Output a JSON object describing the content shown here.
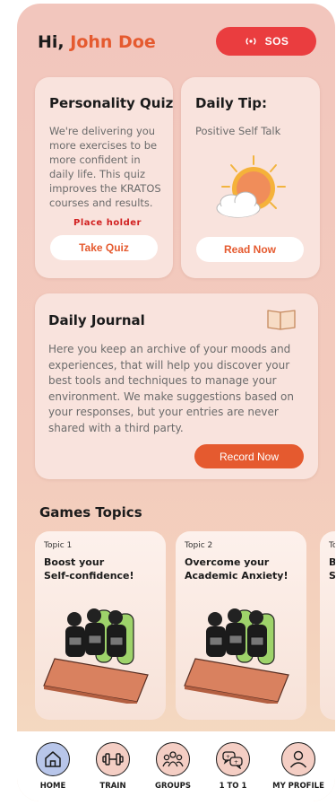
{
  "header": {
    "greeting": "Hi,",
    "user_name": "John Doe",
    "sos_label": "SOS"
  },
  "quiz": {
    "title": "Personality Quiz",
    "body": "We're delivering you more exercises to be more confident in daily life. This quiz improves the KRATOS courses and results.",
    "placeholder": "Place holder",
    "button": "Take Quiz"
  },
  "tip": {
    "title": "Daily Tip:",
    "text": "Positive Self Talk",
    "button": "Read Now",
    "icon": "sun-cloud-illustration"
  },
  "journal": {
    "title": "Daily Journal",
    "body": "Here you keep an archive of your moods and experiences, that will help you discover your best tools and techniques to manage your environment. We make suggestions based on your responses, but your entries are never shared with a third party.",
    "button": "Record Now",
    "icon": "book-icon"
  },
  "games": {
    "section_title": "Games Topics",
    "topics": [
      {
        "number": "Topic 1",
        "title_line1": "Boost your",
        "title_line2": "Self-confidence!"
      },
      {
        "number": "Topic 2",
        "title_line1": "Overcome your",
        "title_line2": "Academic Anxiety!"
      },
      {
        "number": "To",
        "title_line1": "B",
        "title_line2": "S"
      }
    ]
  },
  "nav": {
    "items": [
      {
        "label": "HOME",
        "icon": "home-icon"
      },
      {
        "label": "TRAIN",
        "icon": "dumbbell-icon"
      },
      {
        "label": "GROUPS",
        "icon": "groups-icon"
      },
      {
        "label": "1 TO 1",
        "icon": "chat-icon"
      },
      {
        "label": "MY PROFILE",
        "icon": "profile-icon"
      }
    ]
  },
  "colors": {
    "accent": "#e55a2f",
    "sos": "#ea3d3f",
    "card": "#f9e3dd",
    "active_nav": "#b8c6ea"
  }
}
